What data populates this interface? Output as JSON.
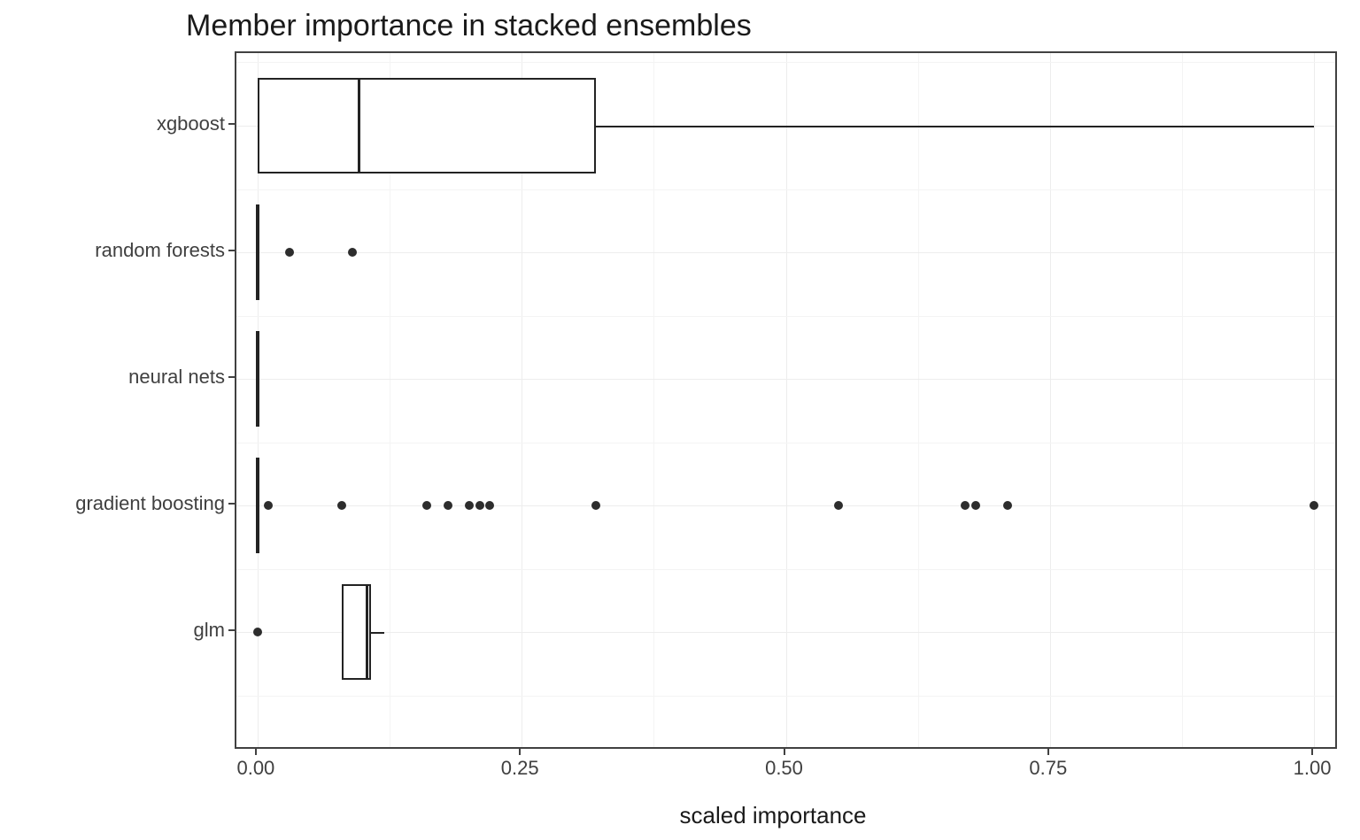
{
  "chart_data": {
    "type": "boxplot-horizontal",
    "title": "Member importance in stacked ensembles",
    "xlabel": "scaled importance",
    "ylabel": "",
    "xlim": [
      -0.02,
      1.02
    ],
    "x_ticks": [
      0.0,
      0.25,
      0.5,
      0.75,
      1.0
    ],
    "x_tick_labels": [
      "0.00",
      "0.25",
      "0.50",
      "0.75",
      "1.00"
    ],
    "categories_top_to_bottom": [
      "xgboost",
      "random forests",
      "neural nets",
      "gradient boosting",
      "glm"
    ],
    "series": [
      {
        "name": "xgboost",
        "lower_whisker": 0.0,
        "q1": 0.0,
        "median": 0.095,
        "q3": 0.32,
        "upper_whisker": 1.0,
        "outliers": []
      },
      {
        "name": "random forests",
        "lower_whisker": 0.0,
        "q1": 0.0,
        "median": 0.0,
        "q3": 0.0,
        "upper_whisker": 0.0,
        "outliers": [
          0.03,
          0.09
        ]
      },
      {
        "name": "neural nets",
        "lower_whisker": 0.0,
        "q1": 0.0,
        "median": 0.0,
        "q3": 0.0,
        "upper_whisker": 0.0,
        "outliers": []
      },
      {
        "name": "gradient boosting",
        "lower_whisker": 0.0,
        "q1": 0.0,
        "median": 0.0,
        "q3": 0.0,
        "upper_whisker": 0.0,
        "outliers": [
          0.01,
          0.08,
          0.16,
          0.18,
          0.2,
          0.21,
          0.22,
          0.32,
          0.55,
          0.67,
          0.68,
          0.71,
          1.0
        ]
      },
      {
        "name": "glm",
        "lower_whisker": 0.08,
        "q1": 0.08,
        "median": 0.102,
        "q3": 0.107,
        "upper_whisker": 0.12,
        "outliers": [
          0.0
        ]
      }
    ]
  }
}
